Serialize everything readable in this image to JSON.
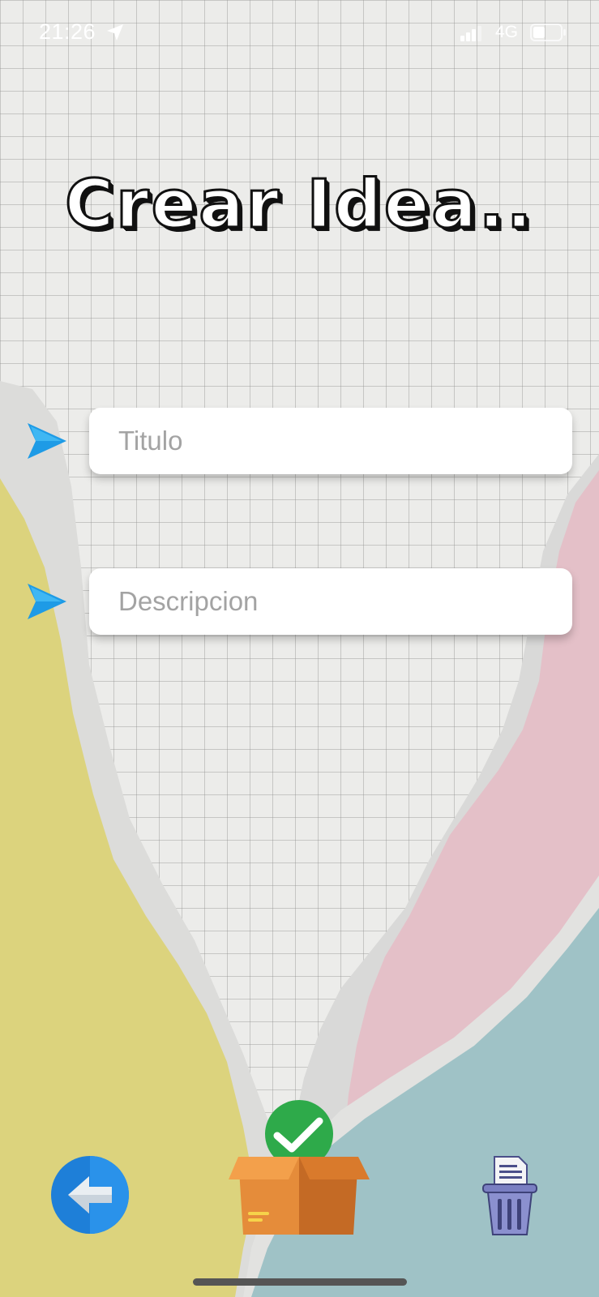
{
  "status_bar": {
    "time": "21:26",
    "network": "4G"
  },
  "header": {
    "title": "Crear Idea.."
  },
  "form": {
    "title_placeholder": "Titulo",
    "description_placeholder": "Descripcion"
  },
  "actions": {
    "back": "back-arrow-icon",
    "save": "box-check-icon",
    "delete": "trash-icon"
  },
  "colors": {
    "accent_arrow": "#1e9be6",
    "paper_yellow": "#dcd37d",
    "paper_pink": "#e4c0c8",
    "paper_teal": "#9fc2c6"
  }
}
